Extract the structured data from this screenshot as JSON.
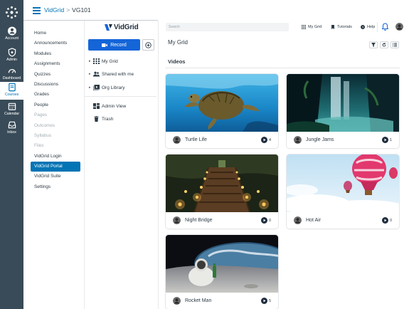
{
  "global_nav": {
    "items": [
      {
        "label": "Account",
        "icon": "user-icon"
      },
      {
        "label": "Admin",
        "icon": "shield-icon"
      },
      {
        "label": "Dashboard",
        "icon": "dashboard-icon"
      },
      {
        "label": "Courses",
        "icon": "book-icon",
        "active": true
      },
      {
        "label": "Calendar",
        "icon": "calendar-icon"
      },
      {
        "label": "Inbox",
        "icon": "inbox-icon"
      }
    ]
  },
  "breadcrumb": {
    "app": "VidGrid",
    "separator": ">",
    "course": "VG101"
  },
  "course_nav": {
    "items": [
      {
        "label": "Home"
      },
      {
        "label": "Announcements"
      },
      {
        "label": "Modules"
      },
      {
        "label": "Assignments"
      },
      {
        "label": "Quizzes"
      },
      {
        "label": "Discussions"
      },
      {
        "label": "Grades"
      },
      {
        "label": "People"
      },
      {
        "label": "Pages",
        "dim": true
      },
      {
        "label": "Outcomes",
        "dim": true
      },
      {
        "label": "Syllabus",
        "dim": true
      },
      {
        "label": "Files",
        "dim": true
      },
      {
        "label": "VidGrid Login"
      },
      {
        "label": "VidGrid Portal",
        "active": true
      },
      {
        "label": "VidGrid Suite"
      },
      {
        "label": "Settings"
      }
    ]
  },
  "vidgrid": {
    "logo_text": "VidGrid",
    "record_label": "Record",
    "tree": [
      {
        "label": "My Grid",
        "icon": "grid-icon"
      },
      {
        "label": "Shared with me",
        "icon": "people-icon"
      },
      {
        "label": "Org Library",
        "icon": "library-icon"
      }
    ],
    "admin_view": "Admin View",
    "trash": "Trash"
  },
  "topbar": {
    "search_placeholder": "Search",
    "my_grid": "My Grid",
    "tutorials": "Tutorials",
    "help": "Help"
  },
  "main": {
    "title": "My Grid",
    "section": "Videos",
    "videos": [
      {
        "title": "Turtle Life",
        "views": "4"
      },
      {
        "title": "Jungle Jams",
        "views": "1"
      },
      {
        "title": "Night Bridge",
        "views": "0"
      },
      {
        "title": "Hot Air",
        "views": "0"
      },
      {
        "title": "Rocket Man",
        "views": "5"
      }
    ]
  },
  "colors": {
    "nav_bg": "#394b58",
    "link": "#0374b5",
    "record": "#1465d8"
  }
}
